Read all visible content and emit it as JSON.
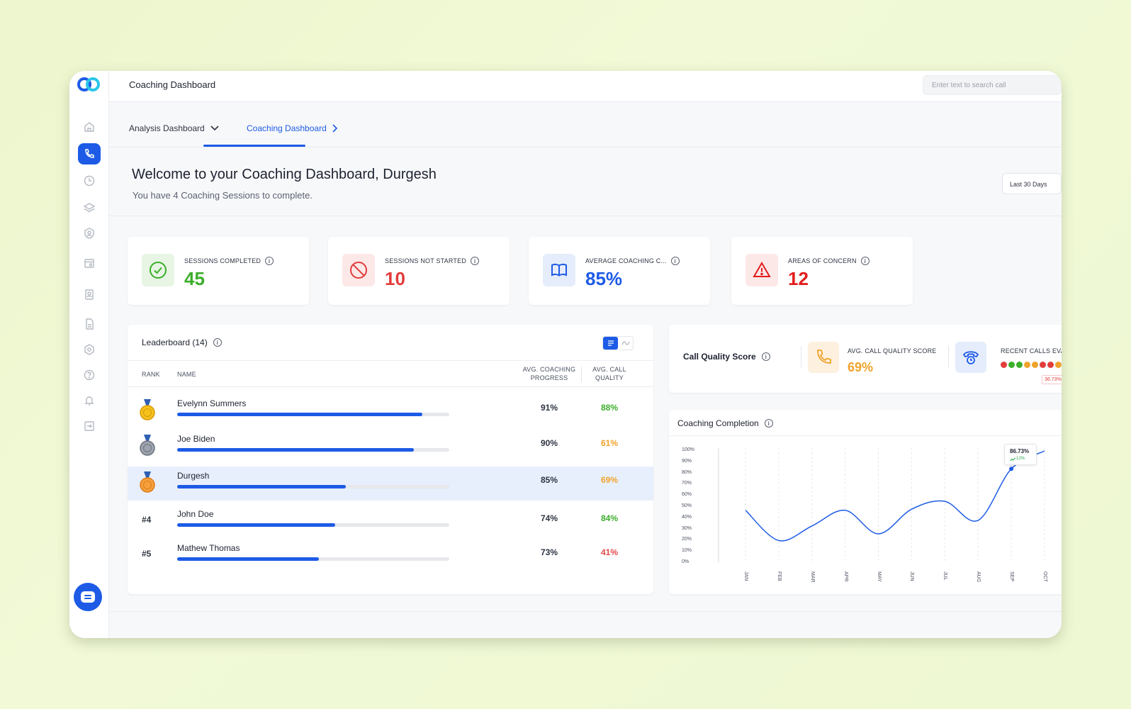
{
  "app": {
    "title": "Coaching Dashboard",
    "search_placeholder": "Enter text to search call"
  },
  "tabs": {
    "analysis": "Analysis Dashboard",
    "coaching": "Coaching Dashboard"
  },
  "welcome": {
    "title": "Welcome to your Coaching Dashboard, Durgesh",
    "subtitle": "You have 4 Coaching Sessions to complete.",
    "date_range": "Last 30 Days"
  },
  "stats": [
    {
      "label": "SESSIONS COMPLETED",
      "value": "45",
      "color": "#3cae2b",
      "icon": "check-circle-icon"
    },
    {
      "label": "SESSIONS NOT STARTED",
      "value": "10",
      "color": "#e23c3c",
      "icon": "ban-icon"
    },
    {
      "label": "AVERAGE COACHING C...",
      "value": "85%",
      "color": "#1d5be6",
      "icon": "book-icon"
    },
    {
      "label": "AREAS OF CONCERN",
      "value": "12",
      "color": "#e21d1d",
      "icon": "warning-icon"
    }
  ],
  "leaderboard": {
    "title": "Leaderboard (14)",
    "columns": {
      "rank": "RANK",
      "name": "NAME",
      "progress": [
        "AVG. COACHING",
        "PROGRESS"
      ],
      "quality": [
        "AVG. CALL",
        "QUALITY"
      ]
    },
    "rows": [
      {
        "rank": "",
        "medal": "gold",
        "name": "Evelynn Summers",
        "progress": "91%",
        "progress_value": 0.9,
        "quality": "88%",
        "quality_color": "#3cae2b"
      },
      {
        "rank": "",
        "medal": "silver",
        "name": "Joe Biden",
        "progress": "90%",
        "progress_value": 0.87,
        "quality": "61%",
        "quality_color": "#f0a32a"
      },
      {
        "rank": "",
        "medal": "bronze",
        "name": "Durgesh",
        "progress": "85%",
        "progress_value": 0.62,
        "quality": "69%",
        "quality_color": "#f0a32a"
      },
      {
        "rank": "#4",
        "medal": "",
        "name": "John Doe",
        "progress": "74%",
        "progress_value": 0.58,
        "quality": "84%",
        "quality_color": "#3cae2b"
      },
      {
        "rank": "#5",
        "medal": "",
        "name": "Mathew Thomas",
        "progress": "73%",
        "progress_value": 0.52,
        "quality": "41%",
        "quality_color": "#e24a4a"
      }
    ]
  },
  "call_quality": {
    "title": "Call Quality Score",
    "avg_label": "AVG. CALL QUALITY SCORE",
    "avg_value": "69%",
    "recent_label": "RECENT CALLS EVA",
    "recent_dots": [
      "#e23c3c",
      "#3cae2b",
      "#3cae2b",
      "#f0a32a",
      "#f0a32a",
      "#e23c3c",
      "#e23c3c",
      "#f0a32a"
    ],
    "recent_tag": "36.73%"
  },
  "coaching_completion": {
    "title": "Coaching Completion",
    "tooltip_value": "86.73%",
    "tooltip_change": "12%"
  },
  "chart_data": {
    "type": "line",
    "title": "Coaching Completion",
    "x": [
      "JAN",
      "FEB",
      "MAR",
      "APR",
      "MAY",
      "JUN",
      "JUL",
      "AUG",
      "SEP",
      "OCT"
    ],
    "y_ticks": [
      "100%",
      "90%",
      "80%",
      "70%",
      "60%",
      "50%",
      "40%",
      "30%",
      "20%",
      "10%",
      "0%"
    ],
    "series": [
      {
        "values": [
          47,
          20,
          33,
          47,
          26,
          48,
          55,
          38,
          84,
          100
        ]
      }
    ],
    "ylim": [
      0,
      100
    ],
    "grid": true
  }
}
